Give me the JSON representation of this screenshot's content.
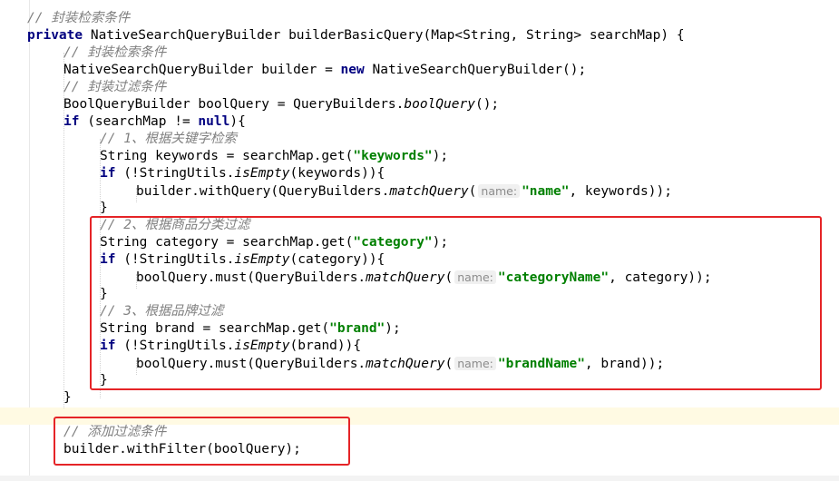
{
  "editor": {
    "lines": [
      {
        "id": "l1",
        "indent": 0,
        "tokens": [
          {
            "c": "cm",
            "t": "// 封装检索条件"
          }
        ]
      },
      {
        "id": "l2",
        "indent": 0,
        "tokens": [
          {
            "c": "kw",
            "t": "private"
          },
          {
            "c": "",
            "t": " NativeSearchQueryBuilder builderBasicQuery(Map<String, String> searchMap) {"
          }
        ]
      },
      {
        "id": "l3",
        "indent": 1,
        "tokens": [
          {
            "c": "cm",
            "t": "// 封装检索条件"
          }
        ]
      },
      {
        "id": "l4",
        "indent": 1,
        "tokens": [
          {
            "c": "",
            "t": "NativeSearchQueryBuilder builder = "
          },
          {
            "c": "kw",
            "t": "new"
          },
          {
            "c": "",
            "t": " NativeSearchQueryBuilder();"
          }
        ]
      },
      {
        "id": "l5",
        "indent": 1,
        "tokens": [
          {
            "c": "cm",
            "t": "// 封装过滤条件"
          }
        ]
      },
      {
        "id": "l6",
        "indent": 1,
        "tokens": [
          {
            "c": "",
            "t": "BoolQueryBuilder boolQuery = QueryBuilders."
          },
          {
            "c": "it",
            "t": "boolQuery"
          },
          {
            "c": "",
            "t": "();"
          }
        ]
      },
      {
        "id": "l7",
        "indent": 1,
        "tokens": [
          {
            "c": "kw",
            "t": "if"
          },
          {
            "c": "",
            "t": " (searchMap != "
          },
          {
            "c": "kw",
            "t": "null"
          },
          {
            "c": "",
            "t": "){"
          }
        ]
      },
      {
        "id": "l8",
        "indent": 2,
        "tokens": [
          {
            "c": "cm",
            "t": "// 1、根据关键字检索"
          }
        ]
      },
      {
        "id": "l9",
        "indent": 2,
        "tokens": [
          {
            "c": "",
            "t": "String keywords = searchMap.get("
          },
          {
            "c": "str",
            "t": "\"keywords\""
          },
          {
            "c": "",
            "t": ");"
          }
        ]
      },
      {
        "id": "l10",
        "indent": 2,
        "tokens": [
          {
            "c": "kw",
            "t": "if"
          },
          {
            "c": "",
            "t": " (!StringUtils."
          },
          {
            "c": "it",
            "t": "isEmpty"
          },
          {
            "c": "",
            "t": "(keywords)){"
          }
        ]
      },
      {
        "id": "l11",
        "indent": 3,
        "tokens": [
          {
            "c": "",
            "t": "builder.withQuery(QueryBuilders."
          },
          {
            "c": "it",
            "t": "matchQuery"
          },
          {
            "c": "",
            "t": "("
          },
          {
            "c": "hint",
            "t": "name:"
          },
          {
            "c": "str",
            "t": "\"name\""
          },
          {
            "c": "",
            "t": ", keywords));"
          }
        ]
      },
      {
        "id": "l12",
        "indent": 2,
        "tokens": [
          {
            "c": "",
            "t": "}"
          }
        ]
      },
      {
        "id": "l13",
        "indent": 2,
        "tokens": [
          {
            "c": "cm",
            "t": "// 2、根据商品分类过滤"
          }
        ]
      },
      {
        "id": "l14",
        "indent": 2,
        "tokens": [
          {
            "c": "",
            "t": "String category = searchMap.get("
          },
          {
            "c": "str",
            "t": "\"category\""
          },
          {
            "c": "",
            "t": ");"
          }
        ]
      },
      {
        "id": "l15",
        "indent": 2,
        "tokens": [
          {
            "c": "kw",
            "t": "if"
          },
          {
            "c": "",
            "t": " (!StringUtils."
          },
          {
            "c": "it",
            "t": "isEmpty"
          },
          {
            "c": "",
            "t": "(category)){"
          }
        ]
      },
      {
        "id": "l16",
        "indent": 3,
        "tokens": [
          {
            "c": "",
            "t": "boolQuery.must(QueryBuilders."
          },
          {
            "c": "it",
            "t": "matchQuery"
          },
          {
            "c": "",
            "t": "("
          },
          {
            "c": "hint",
            "t": "name:"
          },
          {
            "c": "str",
            "t": "\"categoryName\""
          },
          {
            "c": "",
            "t": ", category));"
          }
        ]
      },
      {
        "id": "l17",
        "indent": 2,
        "tokens": [
          {
            "c": "",
            "t": "}"
          }
        ]
      },
      {
        "id": "l18",
        "indent": 2,
        "tokens": [
          {
            "c": "cm",
            "t": "// 3、根据品牌过滤"
          }
        ]
      },
      {
        "id": "l19",
        "indent": 2,
        "tokens": [
          {
            "c": "",
            "t": "String brand = searchMap.get("
          },
          {
            "c": "str",
            "t": "\"brand\""
          },
          {
            "c": "",
            "t": ");"
          }
        ]
      },
      {
        "id": "l20",
        "indent": 2,
        "tokens": [
          {
            "c": "kw",
            "t": "if"
          },
          {
            "c": "",
            "t": " (!StringUtils."
          },
          {
            "c": "it",
            "t": "isEmpty"
          },
          {
            "c": "",
            "t": "(brand)){"
          }
        ]
      },
      {
        "id": "l21",
        "indent": 3,
        "tokens": [
          {
            "c": "",
            "t": "boolQuery.must(QueryBuilders."
          },
          {
            "c": "it",
            "t": "matchQuery"
          },
          {
            "c": "",
            "t": "("
          },
          {
            "c": "hint",
            "t": "name:"
          },
          {
            "c": "str",
            "t": "\"brandName\""
          },
          {
            "c": "",
            "t": ", brand));"
          }
        ]
      },
      {
        "id": "l22",
        "indent": 2,
        "tokens": [
          {
            "c": "",
            "t": "}"
          }
        ]
      },
      {
        "id": "l23",
        "indent": 1,
        "tokens": [
          {
            "c": "",
            "t": "}"
          }
        ]
      },
      {
        "id": "l24",
        "indent": 0,
        "tokens": []
      },
      {
        "id": "l25",
        "indent": 1,
        "tokens": [
          {
            "c": "cm",
            "t": "// 添加过滤条件"
          }
        ]
      },
      {
        "id": "l26",
        "indent": 1,
        "tokens": [
          {
            "c": "",
            "t": "builder.withFilter(boolQuery);"
          }
        ]
      }
    ]
  },
  "colors": {
    "keyword": "#000080",
    "string": "#008000",
    "comment": "#808080",
    "highlight_box": "#e52427",
    "current_line": "#fffae3"
  }
}
